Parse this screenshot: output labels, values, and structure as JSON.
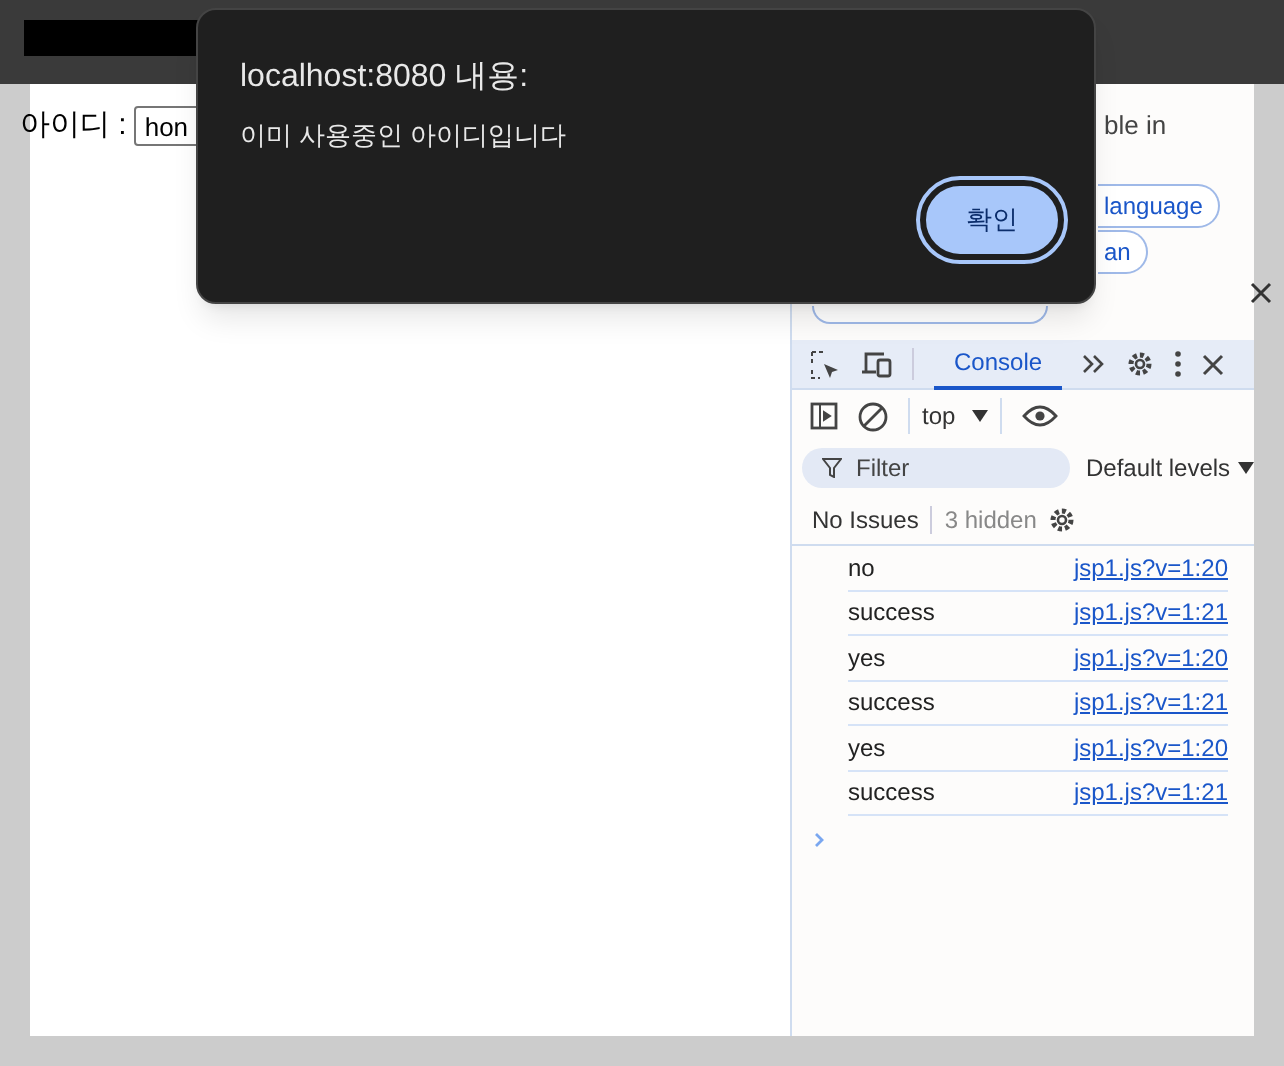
{
  "page": {
    "id_label": "아이디 :",
    "id_value": "hon"
  },
  "translate_bar": {
    "texts": [
      "ble in"
    ],
    "buttons": [
      "language",
      "an"
    ]
  },
  "devtools": {
    "tabs": [
      {
        "label": "Console",
        "selected": true
      }
    ],
    "context": "top",
    "filter_placeholder": "Filter",
    "levels": "Default levels",
    "issues": "No Issues",
    "hidden": "3 hidden",
    "messages": [
      {
        "text": "no",
        "source": "jsp1.js?v=1:20"
      },
      {
        "text": "success",
        "source": "jsp1.js?v=1:21"
      },
      {
        "text": "yes",
        "source": "jsp1.js?v=1:20"
      },
      {
        "text": "success",
        "source": "jsp1.js?v=1:21"
      },
      {
        "text": "yes",
        "source": "jsp1.js?v=1:20"
      },
      {
        "text": "success",
        "source": "jsp1.js?v=1:21"
      }
    ]
  },
  "dialog": {
    "title": "localhost:8080 내용:",
    "message": "이미 사용중인 아이디입니다",
    "button": "확인"
  }
}
